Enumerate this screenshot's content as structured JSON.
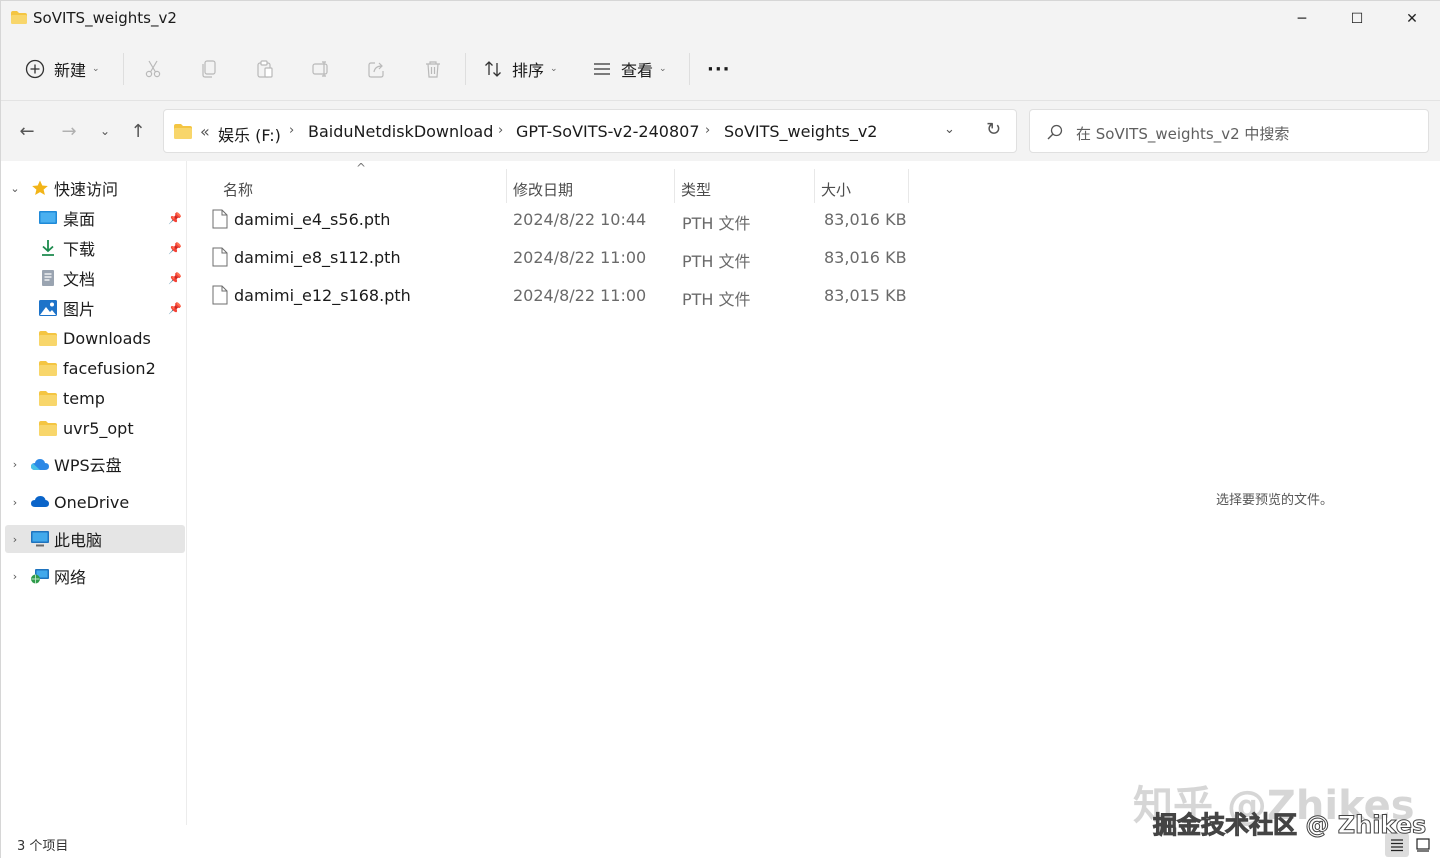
{
  "window": {
    "title": "SoVITS_weights_v2",
    "minimize": "─",
    "maximize": "☐",
    "close": "✕"
  },
  "toolbar": {
    "new_label": "新建",
    "sort_label": "排序",
    "view_label": "查看",
    "more_label": "···"
  },
  "address": {
    "overflow": "«",
    "crumbs": [
      "娱乐 (F:)",
      "BaiduNetdiskDownload",
      "GPT-SoVITS-v2-240807",
      "SoVITS_weights_v2"
    ],
    "separator": "›"
  },
  "search": {
    "placeholder": "在 SoVITS_weights_v2 中搜索"
  },
  "sidebar": {
    "quick_access": "快速访问",
    "items": [
      {
        "label": "桌面",
        "icon": "desktop-icon",
        "pinned": true
      },
      {
        "label": "下载",
        "icon": "download-icon",
        "pinned": true
      },
      {
        "label": "文档",
        "icon": "document-icon",
        "pinned": true
      },
      {
        "label": "图片",
        "icon": "pictures-icon",
        "pinned": true
      },
      {
        "label": "Downloads",
        "icon": "folder-icon",
        "pinned": false
      },
      {
        "label": "facefusion2",
        "icon": "folder-icon",
        "pinned": false
      },
      {
        "label": "temp",
        "icon": "folder-icon",
        "pinned": false
      },
      {
        "label": "uvr5_opt",
        "icon": "folder-icon",
        "pinned": false
      }
    ],
    "wps": "WPS云盘",
    "onedrive": "OneDrive",
    "this_pc": "此电脑",
    "network": "网络"
  },
  "columns": {
    "name": "名称",
    "date": "修改日期",
    "type": "类型",
    "size": "大小"
  },
  "files": [
    {
      "name": "damimi_e4_s56.pth",
      "date": "2024/8/22 10:44",
      "type": "PTH 文件",
      "size": "83,016 KB"
    },
    {
      "name": "damimi_e8_s112.pth",
      "date": "2024/8/22 11:00",
      "type": "PTH 文件",
      "size": "83,016 KB"
    },
    {
      "name": "damimi_e12_s168.pth",
      "date": "2024/8/22 11:00",
      "type": "PTH 文件",
      "size": "83,015 KB"
    }
  ],
  "preview_message": "选择要预览的文件。",
  "status": {
    "item_count": "3 个项目"
  },
  "watermark": {
    "line1": "知乎 @Zhikes",
    "line2": "掘金技术社区 @ Zhikes"
  },
  "colors": {
    "folder": "#f4c542",
    "accent": "#0067c0",
    "chrome": "#f3f3f3"
  }
}
